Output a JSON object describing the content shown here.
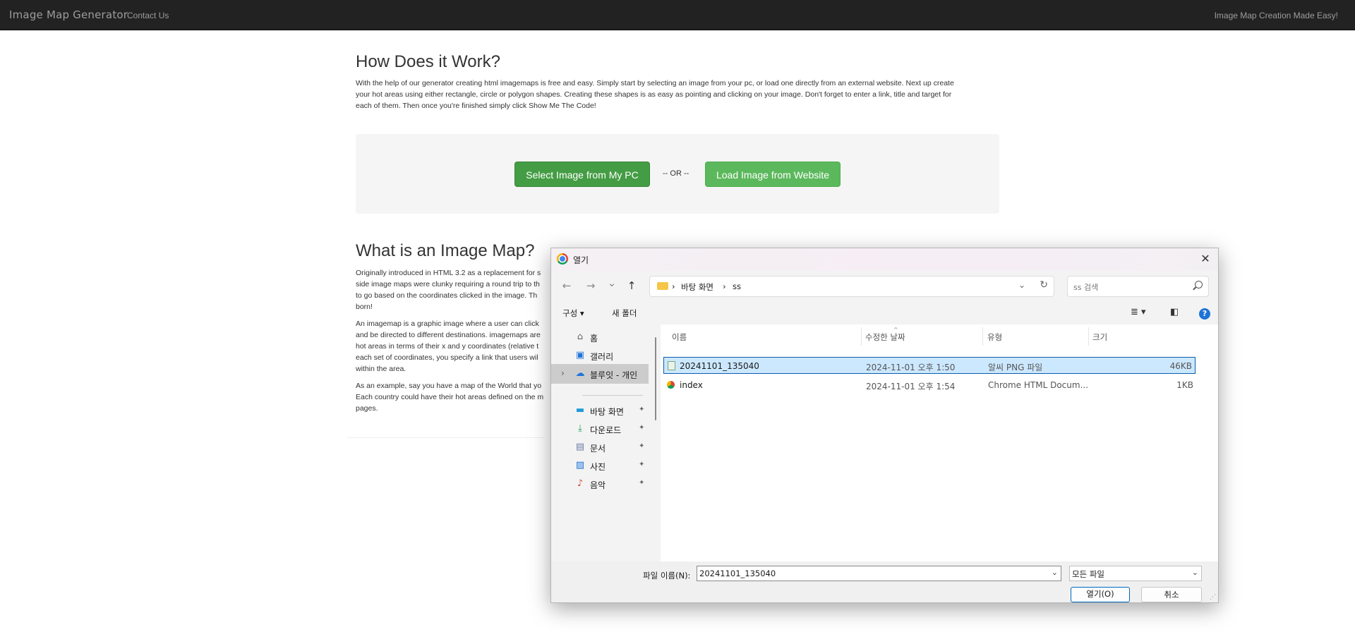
{
  "navbar": {
    "brand": "Image Map Generator",
    "contact": "Contact Us",
    "tagline": "Image Map Creation Made Easy!"
  },
  "how": {
    "heading": "How Does it Work?",
    "lines": [
      "With the help of our generator creating html imagemaps is free and easy. Simply start by selecting an image from your pc, or load one directly from an external website. Next up create",
      "your hot areas using either rectangle, circle or polygon shapes. Creating these shapes is as easy as pointing and clicking on your image. Don't forget to enter a link, title and target for",
      "each of them. Then once you're finished simply click Show Me The Code!"
    ]
  },
  "upload": {
    "select_label": "Select Image from My PC",
    "or_label": "-- OR --",
    "load_label": "Load Image from Website"
  },
  "what": {
    "heading": "What is an Image Map?",
    "p1": [
      "Originally introduced in HTML 3.2 as a replacement for s",
      "side image maps were clunky requiring a round trip to th",
      "to go based on the coordinates clicked in the image. Th",
      "born!"
    ],
    "p2": [
      "An imagemap is a graphic image where a user can click",
      "and be directed to different destinations. imagemaps are",
      "hot areas in terms of their x and y coordinates (relative t",
      "each set of coordinates, you specify a link that users wil",
      "within the area."
    ],
    "p3": [
      "As an example, say you have a map of the World that yo",
      "Each country could have their hot areas defined on the m",
      "pages."
    ]
  },
  "dialog": {
    "title": "열기",
    "close": "✕",
    "nav": {
      "back": "←",
      "forward": "→",
      "recent": "⌄",
      "up": "↑"
    },
    "breadcrumb": [
      "바탕 화면",
      "ss"
    ],
    "search_placeholder": "ss 검색",
    "toolbar": {
      "organize": "구성 ▾",
      "new_folder": "새 폴더",
      "help": "?"
    },
    "sidebar": [
      {
        "label": "홈",
        "icon": "home-icon",
        "glyph": "⌂",
        "pinned": false
      },
      {
        "label": "갤러리",
        "icon": "gallery-icon",
        "glyph": "▣",
        "pinned": false
      },
      {
        "label": "블루잇 - 개인",
        "icon": "cloud-icon",
        "glyph": "☁",
        "pinned": false,
        "selected": true,
        "expand": "›"
      },
      {
        "label": "바탕 화면",
        "icon": "desktop-icon",
        "glyph": "▬",
        "pinned": true
      },
      {
        "label": "다운로드",
        "icon": "download-icon",
        "glyph": "⤓",
        "pinned": true
      },
      {
        "label": "문서",
        "icon": "document-icon",
        "glyph": "▤",
        "pinned": true
      },
      {
        "label": "사진",
        "icon": "pictures-icon",
        "glyph": "▨",
        "pinned": true
      },
      {
        "label": "음악",
        "icon": "music-icon",
        "glyph": "♪",
        "pinned": true
      }
    ],
    "pin_glyph": "📌",
    "columns": {
      "name": "이름",
      "modified": "수정한 날짜",
      "type": "유형",
      "size": "크기"
    },
    "files": [
      {
        "name": "20241101_135040",
        "modified": "2024-11-01 오후 1:50",
        "type": "알씨 PNG 파일",
        "size": "46KB",
        "selected": true
      },
      {
        "name": "index",
        "modified": "2024-11-01 오후 1:54",
        "type": "Chrome HTML Docum...",
        "size": "1KB",
        "selected": false
      }
    ],
    "filename_label": "파일 이름(N):",
    "filename_value": "20241101_135040",
    "filetype_value": "모든 파일",
    "open_label": "열기(O)",
    "cancel_label": "취소"
  },
  "colors": {
    "navbar": "#222222",
    "btn_dark": "#449d44",
    "btn_light": "#5cb85c",
    "selection": "#cce8ff",
    "accent": "#0067c0"
  }
}
